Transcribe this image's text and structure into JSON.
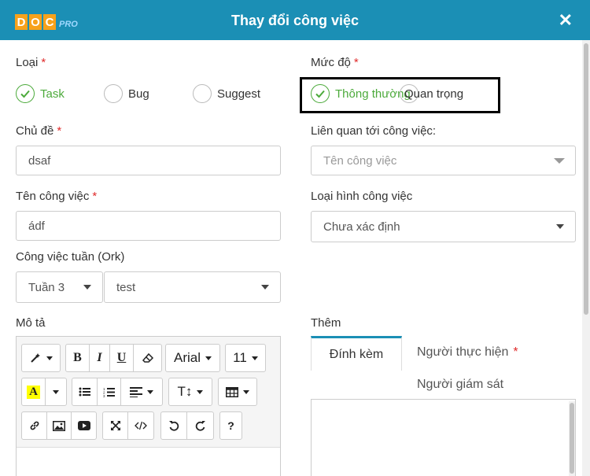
{
  "header": {
    "logo_letters": [
      "D",
      "O",
      "C"
    ],
    "logo_suffix": "PRO",
    "title": "Thay đổi công việc",
    "close_icon": "close-icon"
  },
  "form": {
    "type": {
      "label": "Loại",
      "required": "*",
      "options": [
        "Task",
        "Bug",
        "Suggest"
      ],
      "selected": "Task"
    },
    "priority": {
      "label": "Mức độ",
      "required": "*",
      "options": [
        "Thông thường",
        "Quan trọng"
      ],
      "selected": "Thông thường"
    },
    "topic": {
      "label": "Chủ đề",
      "required": "*",
      "value": "dsaf"
    },
    "related": {
      "label": "Liên quan tới công việc:",
      "placeholder": "Tên công việc"
    },
    "task_name": {
      "label": "Tên công việc",
      "required": "*",
      "value": "ádf"
    },
    "task_kind": {
      "label": "Loại hình công việc",
      "value": "Chưa xác định"
    },
    "weekly": {
      "label": "Công việc tuần (Ork)",
      "week_value": "Tuần 3",
      "item_value": "test"
    },
    "description": {
      "label": "Mô tả",
      "toolbar": {
        "bold": "B",
        "italic": "I",
        "underline": "U",
        "font_family": "Arial",
        "font_size": "11",
        "text_color": "A",
        "line_height": "T↕",
        "help": "?"
      }
    },
    "more": {
      "label": "Thêm",
      "tabs": [
        "Đính kèm",
        "Người thực hiện",
        "Người giám sát"
      ],
      "tab_required": "*",
      "active_tab": "Đính kèm"
    }
  },
  "colors": {
    "header_bg": "#1b8fb5",
    "accent_green": "#4caa3b",
    "required_red": "#e02b2b",
    "logo_orange": "#f7a21b"
  }
}
